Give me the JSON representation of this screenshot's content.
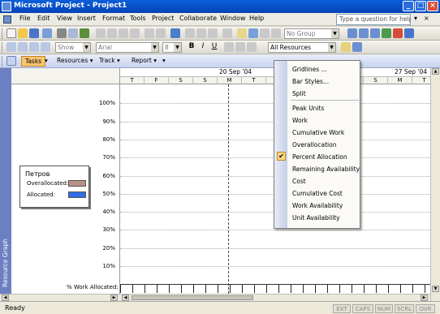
{
  "window": {
    "title": "Microsoft Project - Project1"
  },
  "menubar": {
    "items": [
      "File",
      "Edit",
      "View",
      "Insert",
      "Format",
      "Tools",
      "Project",
      "Collaborate",
      "Window",
      "Help"
    ],
    "help_placeholder": "Type a question for help"
  },
  "toolbar1": {
    "group_combo": "No Group"
  },
  "toolbar2": {
    "font_size_combo": "Show",
    "font_combo": "Arial",
    "size_combo": "8",
    "filter_combo": "All Resources"
  },
  "guidebar": {
    "tasks": "Tasks",
    "resources": "Resources",
    "track": "Track",
    "report": "Report"
  },
  "view": {
    "sidebar_label": "Resource Graph",
    "date_headers": [
      "20 Sep '04",
      "27 Sep '04"
    ],
    "days": [
      "T",
      "F",
      "S",
      "S",
      "M",
      "T",
      "W",
      "T",
      "F",
      "S",
      "S",
      "M",
      "T"
    ],
    "y_labels": [
      "100%",
      "90%",
      "80%",
      "70%",
      "60%",
      "50%",
      "40%",
      "30%",
      "20%",
      "10%"
    ],
    "bottom_label": "% Work Allocated:"
  },
  "legend": {
    "name": "Петров",
    "overallocated": "Overallocated:",
    "allocated": "Allocated:",
    "overallocated_color": "#b89088",
    "allocated_color": "#2f6de8"
  },
  "context_menu": {
    "items": [
      "Gridlines ...",
      "Bar Styles...",
      "Split",
      "Peak Units",
      "Work",
      "Cumulative Work",
      "Overallocation",
      "Percent Allocation",
      "Remaining Availability",
      "Cost",
      "Cumulative Cost",
      "Work Availability",
      "Unit Availability"
    ],
    "checked": "Percent Allocation"
  },
  "status": {
    "text": "Ready",
    "indicators": [
      "EXT",
      "CAPS",
      "NUM",
      "SCRL",
      "OVR"
    ]
  }
}
